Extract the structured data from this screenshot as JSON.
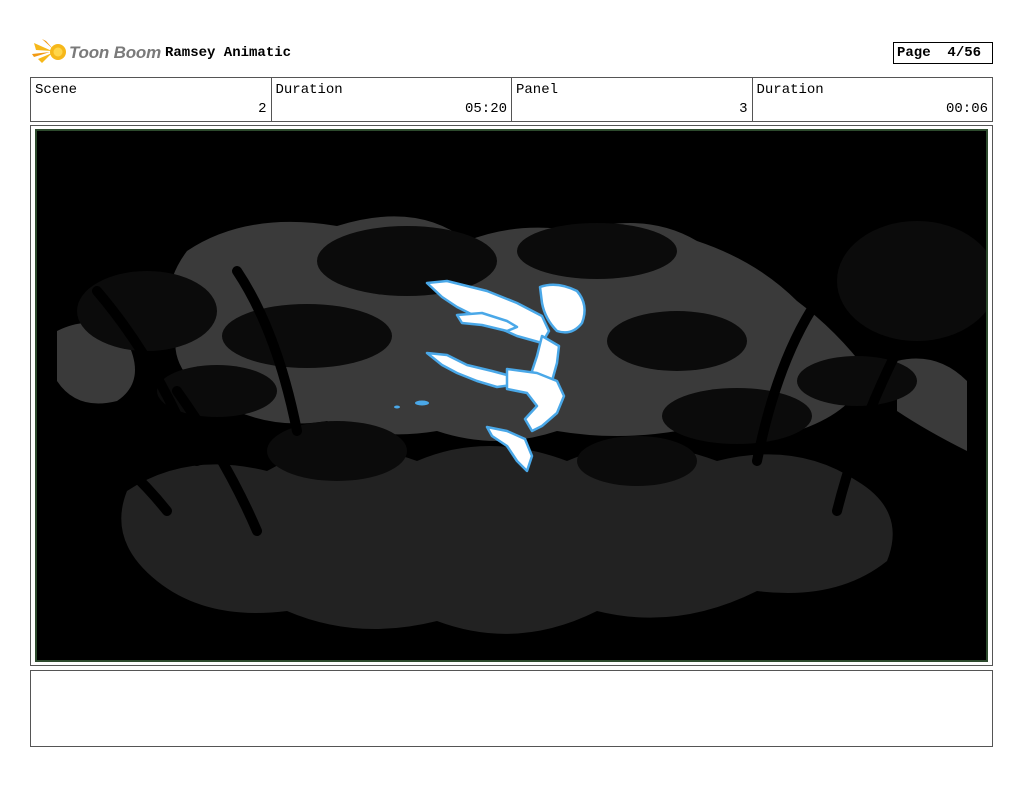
{
  "header": {
    "brand": "Toon Boom",
    "project_title": "Ramsey Animatic",
    "page_label": "Page",
    "page_value": "4/56"
  },
  "info": {
    "scene_label": "Scene",
    "scene_value": "2",
    "scene_duration_label": "Duration",
    "scene_duration_value": "05:20",
    "panel_label": "Panel",
    "panel_value": "3",
    "panel_duration_label": "Duration",
    "panel_duration_value": "00:06"
  },
  "panel": {
    "background_color": "#000000",
    "figure_color": "#4aa8e8"
  },
  "notes": {
    "text": ""
  }
}
